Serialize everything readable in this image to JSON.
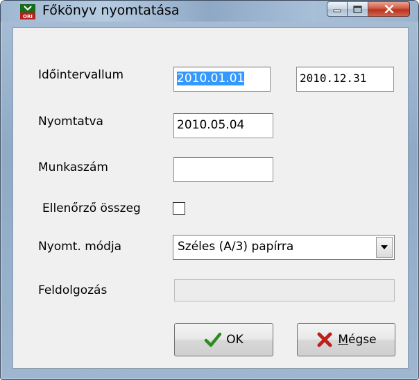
{
  "window": {
    "title": "Főkönyv nyomtatása",
    "app_icon": "app-icon"
  },
  "form": {
    "interval_label": "Időintervallum",
    "interval_from": "2010.01.01",
    "interval_to": "2010.12.31",
    "printed_label": "Nyomtatva",
    "printed_value": "2010.05.04",
    "job_number_label": "Munkaszám",
    "job_number_value": "",
    "checksum_label": "Ellenőrző összeg",
    "checksum_checked": false,
    "print_mode_label": "Nyomt. módja",
    "print_mode_value": "Széles (A/3) papírra",
    "processing_label": "Feldolgozás",
    "processing_progress": 0
  },
  "buttons": {
    "ok_label": "OK",
    "cancel_label": "Mégse"
  },
  "colors": {
    "selection": "#3399ff",
    "ok_check": "#2e8b1e",
    "cancel_x": "#c0201a"
  }
}
